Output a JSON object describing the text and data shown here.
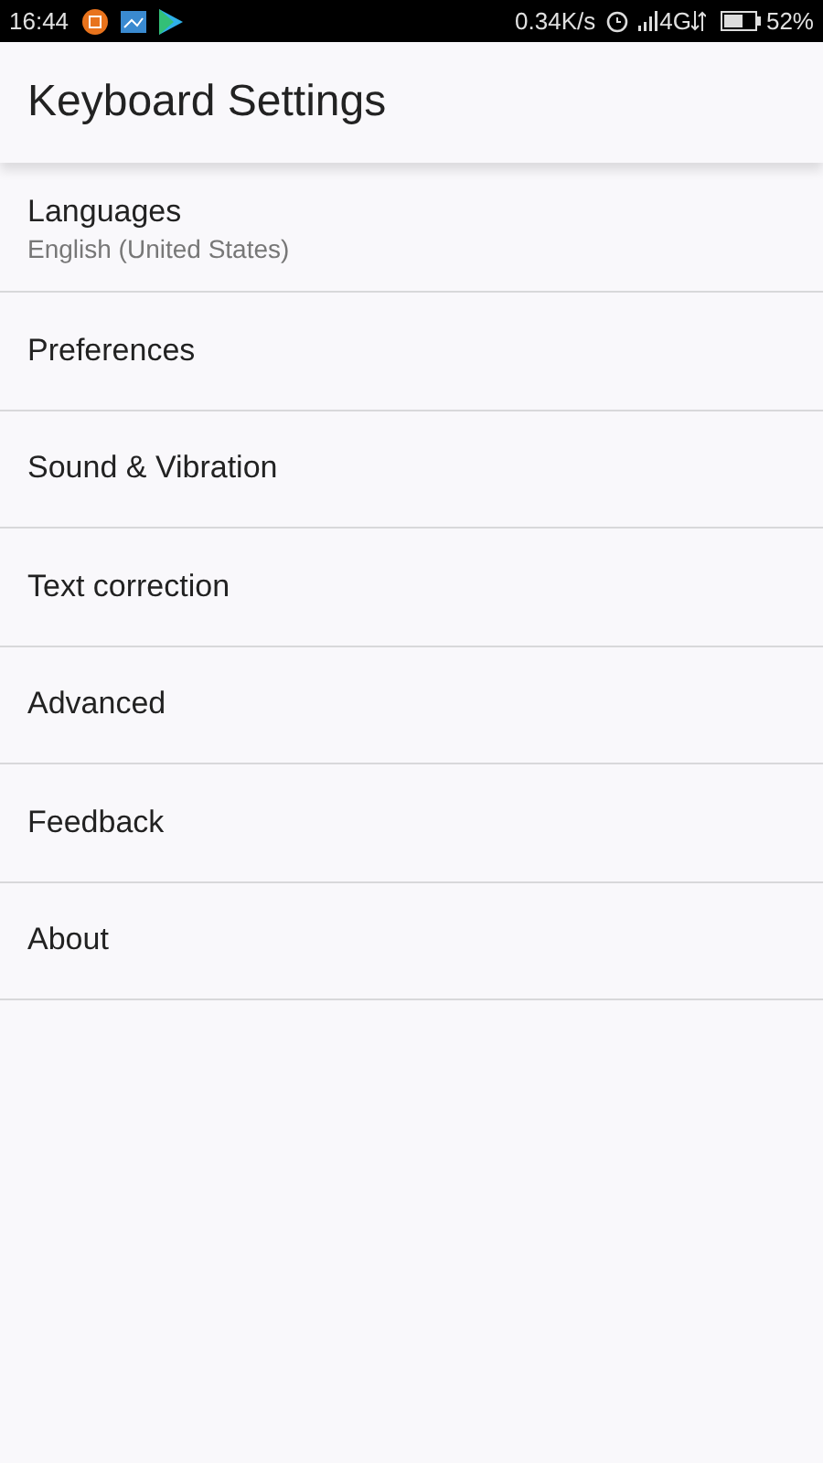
{
  "status_bar": {
    "time": "16:44",
    "speed": "0.34K/s",
    "network": "4G",
    "battery": "52%"
  },
  "app_bar": {
    "title": "Keyboard Settings"
  },
  "items": [
    {
      "title": "Languages",
      "subtitle": "English (United States)"
    },
    {
      "title": "Preferences"
    },
    {
      "title": "Sound & Vibration"
    },
    {
      "title": "Text correction"
    },
    {
      "title": "Advanced"
    },
    {
      "title": "Feedback"
    },
    {
      "title": "About"
    }
  ]
}
